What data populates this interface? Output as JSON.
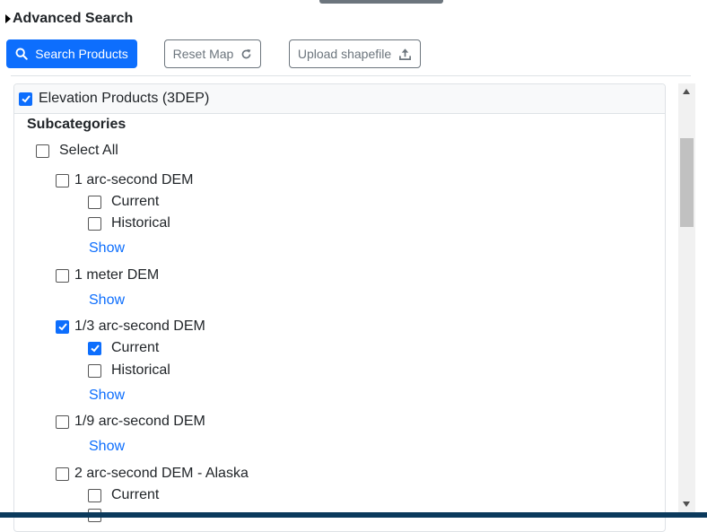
{
  "header": {
    "title": "Advanced Search"
  },
  "toolbar": {
    "search_label": "Search Products",
    "reset_label": "Reset Map",
    "upload_label": "Upload shapefile"
  },
  "category": {
    "label": "Elevation Products (3DEP)",
    "checked": true
  },
  "subcategories": {
    "title": "Subcategories",
    "select_all": "Select All",
    "items": [
      {
        "label": "1 arc-second DEM",
        "checked": false,
        "children": [
          {
            "label": "Current",
            "checked": false
          },
          {
            "label": "Historical",
            "checked": false
          }
        ],
        "link": "Show"
      },
      {
        "label": "1 meter DEM",
        "checked": false,
        "link": "Show"
      },
      {
        "label": "1/3 arc-second DEM",
        "checked": true,
        "children": [
          {
            "label": "Current",
            "checked": true
          },
          {
            "label": "Historical",
            "checked": false
          }
        ],
        "link": "Show"
      },
      {
        "label": "1/9 arc-second DEM",
        "checked": false,
        "link": "Show"
      },
      {
        "label": "2 arc-second DEM - Alaska",
        "checked": false,
        "children": [
          {
            "label": "Current",
            "checked": false
          }
        ]
      }
    ]
  },
  "colors": {
    "primary": "#0d6efd",
    "secondary": "#6c757d",
    "border": "#dee2e6"
  }
}
